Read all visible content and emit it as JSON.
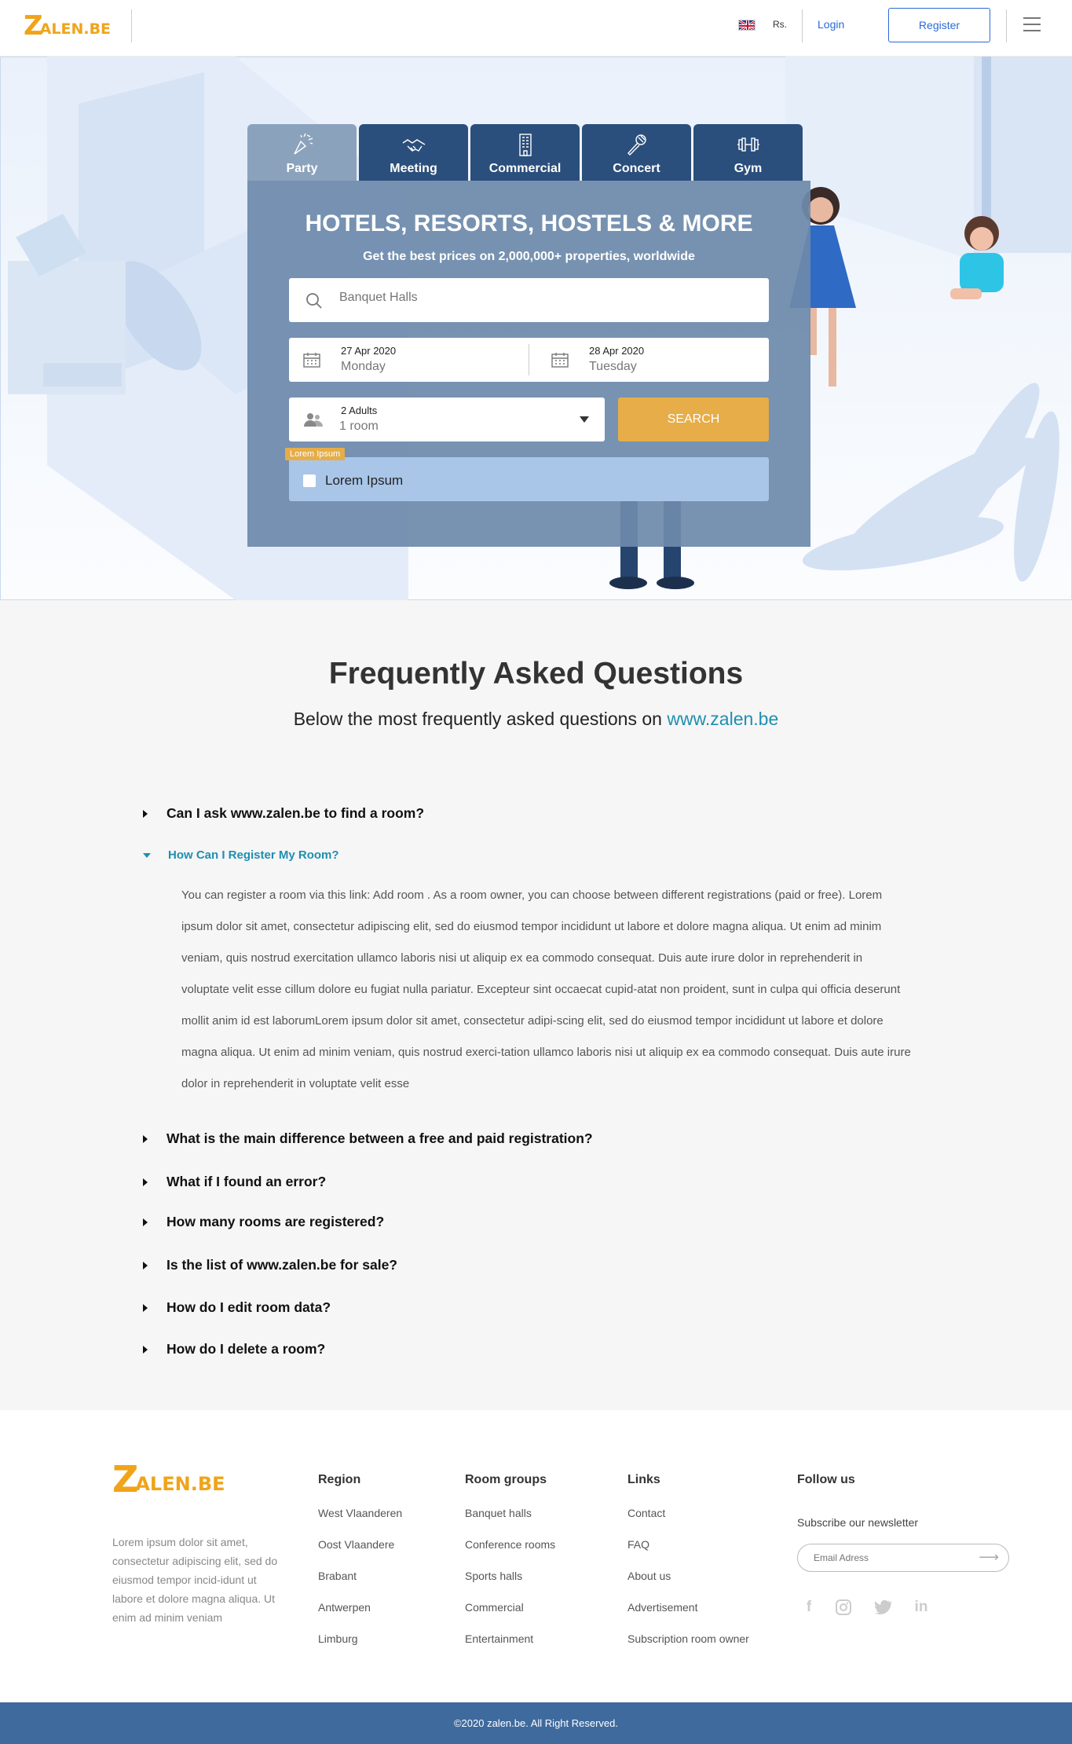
{
  "header": {
    "logo_text": "ZALEN.BE",
    "currency": "Rs.",
    "login_label": "Login",
    "register_label": "Register"
  },
  "hero": {
    "tabs": [
      {
        "label": "Party",
        "icon": "party-icon",
        "active": true
      },
      {
        "label": "Meeting",
        "icon": "handshake-icon",
        "active": false
      },
      {
        "label": "Commercial",
        "icon": "building-icon",
        "active": false
      },
      {
        "label": "Concert",
        "icon": "microphone-icon",
        "active": false
      },
      {
        "label": "Gym",
        "icon": "dumbbell-icon",
        "active": false
      }
    ],
    "title": "HOTELS, RESORTS, HOSTELS & MORE",
    "subtitle": "Get the best prices on 2,000,000+ properties, worldwide",
    "search_placeholder": "Banquet Halls",
    "checkin_date": "27 Apr 2020",
    "checkin_day": "Monday",
    "checkout_date": "28 Apr 2020",
    "checkout_day": "Tuesday",
    "guests": "2 Adults",
    "rooms": "1 room",
    "search_button": "SEARCH",
    "lorem_tag": "Lorem Ipsum",
    "lorem_checkbox": "Lorem Ipsum",
    "accent_color": "#e6ad48"
  },
  "faq": {
    "title": "Frequently Asked Questions",
    "subtitle_prefix": "Below the most frequently asked questions on ",
    "subtitle_link": "www.zalen.be",
    "questions": [
      "Can I ask www.zalen.be to find a room?",
      "How Can I Register My Room?",
      "What is the main difference between a free and paid registration?",
      "What if I found an error?",
      "How many rooms are registered?",
      "Is the list of www.zalen.be for sale?",
      "How do I edit room data?",
      "How do I delete a room?"
    ],
    "open_answer": "You can register a room via this link: Add room . As a room owner, you can choose between different registrations (paid or free). Lorem ipsum dolor sit amet, consectetur adipiscing elit, sed do eiusmod tempor incididunt ut labore et dolore magna aliqua. Ut enim ad minim veniam, quis nostrud exercitation ullamco laboris nisi ut aliquip ex ea commodo consequat. Duis aute irure dolor in reprehenderit in voluptate velit esse cillum dolore eu fugiat nulla pariatur. Excepteur sint occaecat cupid-atat non proident, sunt in culpa qui officia deserunt mollit anim id est laborumLorem ipsum dolor sit amet, consectetur adipi-scing elit, sed do eiusmod tempor incididunt ut labore et dolore magna aliqua. Ut enim ad minim veniam, quis nostrud exerci-tation ullamco laboris nisi ut aliquip ex ea commodo consequat. Duis aute irure dolor in reprehenderit in voluptate velit esse"
  },
  "footer": {
    "logo_text": "ZALEN.BE",
    "description": "Lorem ipsum dolor sit amet, consectetur adipiscing elit, sed do eiusmod tempor incid-idunt ut labore et dolore magna aliqua. Ut enim ad minim veniam",
    "region": {
      "title": "Region",
      "items": [
        "West Vlaanderen",
        "Oost Vlaandere",
        "Brabant",
        "Antwerpen",
        "Limburg"
      ]
    },
    "room_groups": {
      "title": "Room groups",
      "items": [
        "Banquet halls",
        "Conference rooms",
        "Sports halls",
        "Commercial",
        "Entertainment"
      ]
    },
    "links": {
      "title": "Links",
      "items": [
        "Contact",
        "FAQ",
        "About us",
        "Advertisement",
        "Subscription room owner"
      ]
    },
    "follow": {
      "title": "Follow us",
      "newsletter": "Subscribe our newsletter",
      "email_placeholder": "Email Adress"
    },
    "social_icons": [
      "facebook-icon",
      "instagram-icon",
      "twitter-icon",
      "linkedin-icon"
    ],
    "copyright": "©2020 zalen.be. All Right Reserved."
  }
}
